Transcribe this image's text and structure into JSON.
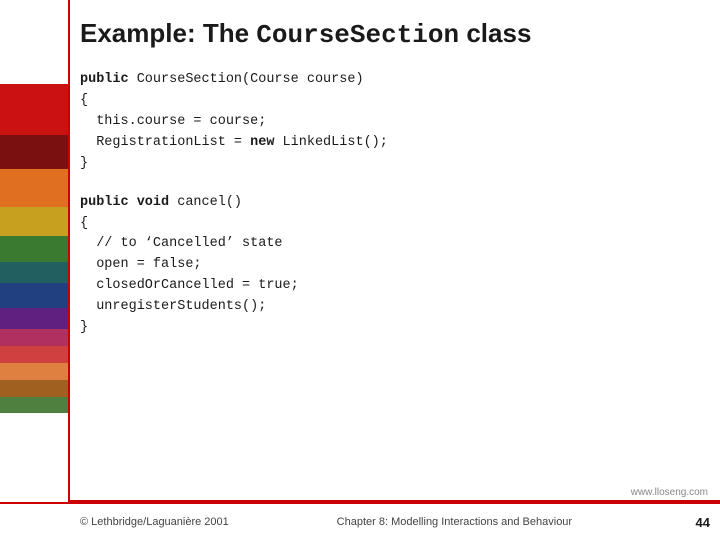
{
  "slide": {
    "title_plain": "Example: The ",
    "title_mono": "CourseSection",
    "title_suffix": " class",
    "code_block1": [
      "public CourseSection(Course course)",
      "{",
      "  this.course = course;",
      "  RegistrationList = new LinkedList();",
      "}"
    ],
    "code_block2": [
      "public void cancel()",
      "{",
      "  // to ‘Cancelled’ state",
      "  open = false;",
      "  closedOrCancelled = true;",
      "  unregisterStudents();",
      "}"
    ],
    "watermark": "www.lloseng.com",
    "footer_left": "© Lethbridge/Laguanière 2001",
    "footer_center": "Chapter 8: Modelling Interactions and Behaviour",
    "footer_right": "44"
  }
}
